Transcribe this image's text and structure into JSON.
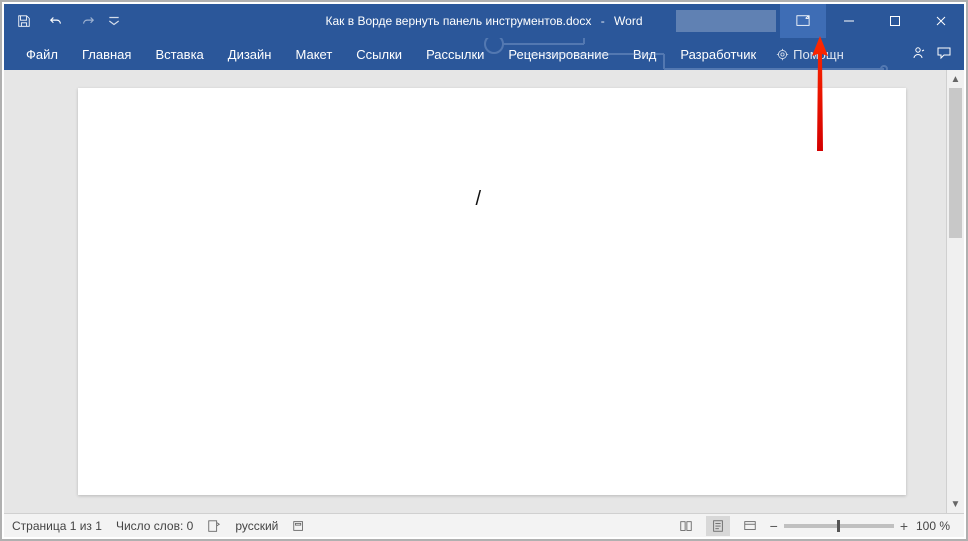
{
  "titlebar": {
    "document_name": "Как в Ворде вернуть панель инструментов.docx",
    "separator": "-",
    "app_name": "Word"
  },
  "ribbon": {
    "tabs": [
      "Файл",
      "Главная",
      "Вставка",
      "Дизайн",
      "Макет",
      "Ссылки",
      "Рассылки",
      "Рецензирование",
      "Вид",
      "Разработчик"
    ],
    "tell_me": "Помощн"
  },
  "document": {
    "cursor_glyph": "/"
  },
  "statusbar": {
    "page_info": "Страница 1 из 1",
    "word_count": "Число слов: 0",
    "language": "русский",
    "zoom_pct": "100 %"
  },
  "colors": {
    "brand": "#2b579a",
    "brand_light": "#3e6db5",
    "workspace_bg": "#e6e6e6"
  }
}
